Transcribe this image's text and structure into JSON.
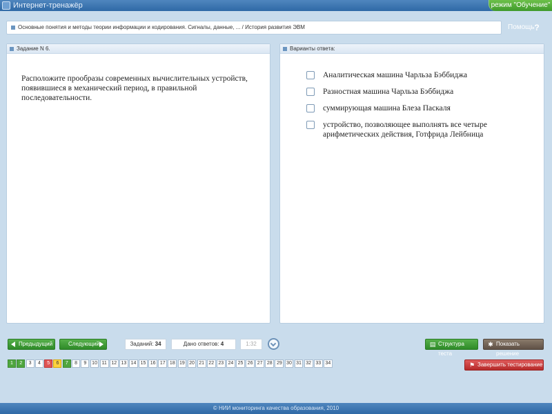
{
  "app": {
    "title": "Интернет-тренажёр",
    "mode": "режим \"Обучение\""
  },
  "breadcrumb": "Основные понятия и методы теории информации и кодирования. Сигналы, данные, ... / История развития ЭВМ",
  "help": {
    "label": "Помощь",
    "icon": "?"
  },
  "task": {
    "header": "Задание N 6.",
    "question": "Расположите прообразы современных вычислительных устройств, появившиеся в механический период, в правильной последовательности."
  },
  "answers": {
    "header": "Варианты ответа:",
    "items": [
      "Аналитическая машина Чарльза Бэббиджа",
      "Разностная машина Чарльза Бэббиджа",
      "суммирующая машина Блеза Паскаля",
      "устройство, позволяющее выполнять все четыре арифметических действия, Готфрида Лейбница"
    ]
  },
  "nav": {
    "prev": "Предыдущий",
    "next": "Следующий"
  },
  "stats": {
    "tasks_label": "Заданий:",
    "tasks_value": "34",
    "answered_label": "Дано ответов:",
    "answered_value": "4",
    "timer": "1:32"
  },
  "actions": {
    "structure": "Структура теста",
    "show_solution": "Показать решение",
    "finish": "Завершить тестирование"
  },
  "pager": [
    {
      "n": "1",
      "state": "done"
    },
    {
      "n": "2",
      "state": "done"
    },
    {
      "n": "3",
      "state": "normal"
    },
    {
      "n": "4",
      "state": "normal"
    },
    {
      "n": "5",
      "state": "wrong"
    },
    {
      "n": "6",
      "state": "current"
    },
    {
      "n": "7",
      "state": "done"
    },
    {
      "n": "8",
      "state": "normal"
    },
    {
      "n": "9",
      "state": "normal"
    },
    {
      "n": "10",
      "state": "normal"
    },
    {
      "n": "11",
      "state": "normal"
    },
    {
      "n": "12",
      "state": "normal"
    },
    {
      "n": "13",
      "state": "normal"
    },
    {
      "n": "14",
      "state": "normal"
    },
    {
      "n": "15",
      "state": "normal"
    },
    {
      "n": "16",
      "state": "normal"
    },
    {
      "n": "17",
      "state": "normal"
    },
    {
      "n": "18",
      "state": "normal"
    },
    {
      "n": "19",
      "state": "normal"
    },
    {
      "n": "20",
      "state": "normal"
    },
    {
      "n": "21",
      "state": "normal"
    },
    {
      "n": "22",
      "state": "normal"
    },
    {
      "n": "23",
      "state": "normal"
    },
    {
      "n": "24",
      "state": "normal"
    },
    {
      "n": "25",
      "state": "normal"
    },
    {
      "n": "26",
      "state": "normal"
    },
    {
      "n": "27",
      "state": "normal"
    },
    {
      "n": "28",
      "state": "normal"
    },
    {
      "n": "29",
      "state": "normal"
    },
    {
      "n": "30",
      "state": "normal"
    },
    {
      "n": "31",
      "state": "normal"
    },
    {
      "n": "32",
      "state": "normal"
    },
    {
      "n": "33",
      "state": "normal"
    },
    {
      "n": "34",
      "state": "normal"
    }
  ],
  "footer": "© НИИ мониторинга качества образования, 2010",
  "colors": {
    "titlebar": "#2f69a6",
    "accent_green": "#3f9a2b",
    "wrong": "#e05555",
    "current": "#ffd23f"
  }
}
